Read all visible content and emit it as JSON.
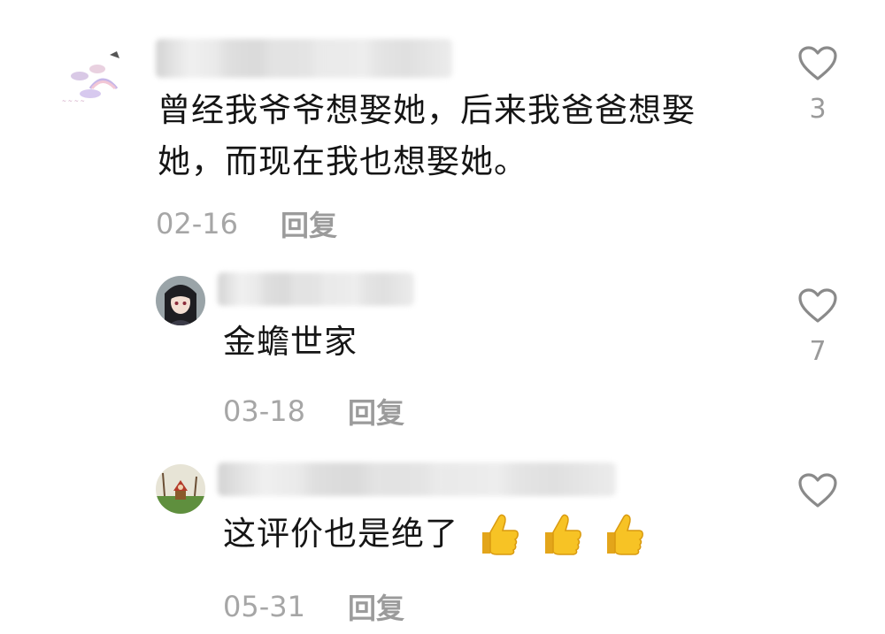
{
  "comments": [
    {
      "text_line1": "曾经我爷爷想娶她，后来我爸爸想娶",
      "text_line2": "她，而现在我也想娶她。",
      "date": "02-16",
      "reply_label": "回复",
      "like_count": "3"
    },
    {
      "text": "金蟾世家",
      "date": "03-18",
      "reply_label": "回复",
      "like_count": "7"
    },
    {
      "text": "这评价也是绝了",
      "emojis": [
        "thumbs-up",
        "thumbs-up",
        "thumbs-up"
      ],
      "date": "05-31",
      "reply_label": "回复",
      "like_count": ""
    }
  ],
  "icons": {
    "like": "heart-outline-icon",
    "emoji": "thumbs-up-emoji"
  },
  "colors": {
    "text": "#151515",
    "meta": "#a6a6a6",
    "reply": "#9b9b9b",
    "heart": "#8a8a8a",
    "emoji": "#f7c325"
  }
}
